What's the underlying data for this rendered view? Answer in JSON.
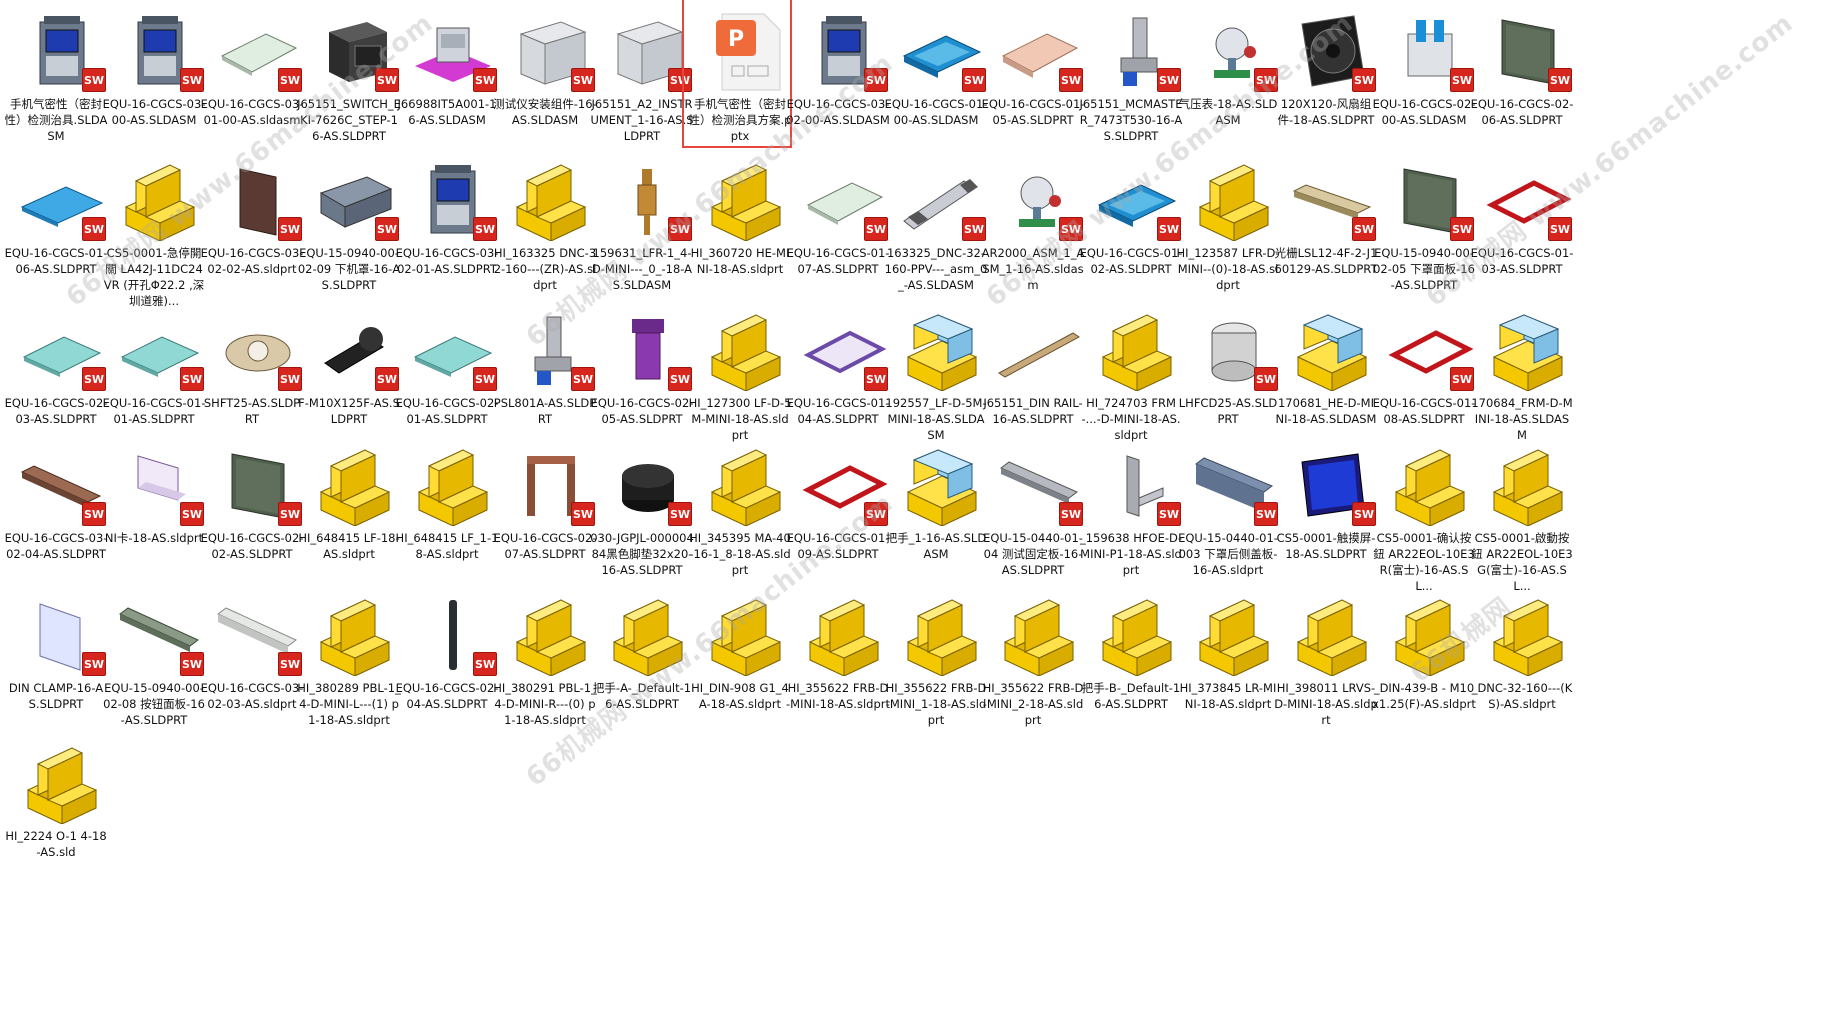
{
  "files": [
    {
      "label": "手机气密性（密封性）检测治具.SLDASM",
      "thumb": "machine",
      "sw": true
    },
    {
      "label": "EQU-16-CGCS-03-00-AS.SLDASM",
      "thumb": "machine",
      "sw": true
    },
    {
      "label": "EQU-16-CGCS-03-01-00-AS.sldasm",
      "thumb": "plate",
      "sw": true
    },
    {
      "label": "J65151_SWITCH_EKI-7626C_STEP-16-AS.SLDPRT",
      "thumb": "box-dark",
      "sw": true
    },
    {
      "label": "J66988IT5A001-16-AS.SLDASM",
      "thumb": "magenta",
      "sw": true
    },
    {
      "label": "测试仪安装组件-16-AS.SLDASM",
      "thumb": "box-gray",
      "sw": true
    },
    {
      "label": "J65151_A2_INSTRUMENT_1-16-AS.SLDPRT",
      "thumb": "box-gray",
      "sw": true
    },
    {
      "label": "手机气密性（密封性）检测治具方案.pptx",
      "thumb": "pptx",
      "sw": false,
      "selected": true
    },
    {
      "label": "EQU-16-CGCS-03-02-00-AS.SLDASM",
      "thumb": "machine",
      "sw": true
    },
    {
      "label": "EQU-16-CGCS-01-00-AS.SLDASM",
      "thumb": "blue-tray",
      "sw": true
    },
    {
      "label": "EQU-16-CGCS-01-05-AS.SLDPRT",
      "thumb": "plate-tan",
      "sw": true
    },
    {
      "label": "J65151_MCMASTER_7473T530-16-AS.SLDPRT",
      "thumb": "fitting",
      "sw": true
    },
    {
      "label": "气压表-18-AS.SLDASM",
      "thumb": "gauge",
      "sw": true
    },
    {
      "label": "120X120-风扇组件-18-AS.SLDPRT",
      "thumb": "fan",
      "sw": true
    },
    {
      "label": "EQU-16-CGCS-02-00-AS.SLDASM",
      "thumb": "frame-blue",
      "sw": true
    },
    {
      "label": "EQU-16-CGCS-02-06-AS.SLDPRT",
      "thumb": "plate-green",
      "sw": true
    },
    {
      "label": "EQU-16-CGCS-01-06-AS.SLDPRT",
      "thumb": "blue-plate",
      "sw": true
    },
    {
      "label": "CS5-0001-急停開關 LA42J-11DC24VR (开孔Φ22.2 ,深圳道雅)...",
      "thumb": "yellow",
      "sw": false
    },
    {
      "label": "EQU-16-CGCS-03-02-02-AS.sldprt",
      "thumb": "brown-panel",
      "sw": true
    },
    {
      "label": "EQU-15-0940-00-02-09 下机罩-16-AS.SLDPRT",
      "thumb": "cover",
      "sw": true
    },
    {
      "label": "EQU-16-CGCS-03-02-01-AS.SLDPRT",
      "thumb": "machine",
      "sw": true
    },
    {
      "label": "HI_163325 DNC-32-160---(ZR)-AS.sldprt",
      "thumb": "yellow",
      "sw": false
    },
    {
      "label": "159631_LFR-1_4-D-MINI---_0_-18-AS.SLDASM",
      "thumb": "valve",
      "sw": true
    },
    {
      "label": "HI_360720 HE-MINI-18-AS.sldprt",
      "thumb": "yellow",
      "sw": false
    },
    {
      "label": "EQU-16-CGCS-01-07-AS.SLDPRT",
      "thumb": "plate",
      "sw": true
    },
    {
      "label": "163325_DNC-32-160-PPV---_asm_0_-AS.SLDASM",
      "thumb": "cylinder",
      "sw": true
    },
    {
      "label": "AR2000_ASM_1_ASM_1-16-AS.sldasm",
      "thumb": "gauge",
      "sw": true
    },
    {
      "label": "EQU-16-CGCS-01-02-AS.SLDPRT",
      "thumb": "blue-tray",
      "sw": true
    },
    {
      "label": "HI_123587 LFR-D-MINI--(0)-18-AS.sldprt",
      "thumb": "yellow",
      "sw": false
    },
    {
      "label": "光栅LSL12-4F-2-J160129-AS.SLDPRT",
      "thumb": "rail",
      "sw": true
    },
    {
      "label": "EQU-15-0940-00-02-05 下罩面板-16-AS.SLDPRT",
      "thumb": "plate-green",
      "sw": true
    },
    {
      "label": "EQU-16-CGCS-01-03-AS.SLDPRT",
      "thumb": "red-ring",
      "sw": true
    },
    {
      "label": "EQU-16-CGCS-02-03-AS.SLDPRT",
      "thumb": "teal-plate",
      "sw": true
    },
    {
      "label": "EQU-16-CGCS-01-01-AS.SLDPRT",
      "thumb": "teal-plate",
      "sw": true
    },
    {
      "label": "SHFT25-AS.SLDPRT",
      "thumb": "bearing",
      "sw": true
    },
    {
      "label": "F-M10X125F-AS.SLDPRT",
      "thumb": "black-part",
      "sw": true
    },
    {
      "label": "EQU-16-CGCS-02-01-AS.SLDPRT",
      "thumb": "teal-plate",
      "sw": true
    },
    {
      "label": "PSL801A-AS.SLDPRT",
      "thumb": "fitting",
      "sw": true
    },
    {
      "label": "EQU-16-CGCS-02-05-AS.SLDPRT",
      "thumb": "purple",
      "sw": true
    },
    {
      "label": "HI_127300 LF-D-5M-MINI-18-AS.sldprt",
      "thumb": "yellow",
      "sw": false
    },
    {
      "label": "EQU-16-CGCS-01-04-AS.SLDPRT",
      "thumb": "purple-frame",
      "sw": true
    },
    {
      "label": "192557_LF-D-5M-MINI-18-AS.SLDASM",
      "thumb": "yellow-blue",
      "sw": false
    },
    {
      "label": "J65151_DIN RAIL-16-AS.SLDPRT",
      "thumb": "rod",
      "sw": false
    },
    {
      "label": "HI_724703 FRM-...-D-MINI-18-AS.sldprt",
      "thumb": "yellow",
      "sw": false
    },
    {
      "label": "LHFCD25-AS.SLDPRT",
      "thumb": "bushing",
      "sw": true
    },
    {
      "label": "170681_HE-D-MINI-18-AS.SLDASM",
      "thumb": "yellow-blue",
      "sw": false
    },
    {
      "label": "EQU-16-CGCS-01-08-AS.SLDPRT",
      "thumb": "red-ring",
      "sw": true
    },
    {
      "label": "170684_FRM-D-MINI-18-AS.SLDASM",
      "thumb": "yellow-blue",
      "sw": false
    },
    {
      "label": "EQU-16-CGCS-03-02-04-AS.SLDPRT",
      "thumb": "bar",
      "sw": true
    },
    {
      "label": "NI卡-18-AS.sldprt",
      "thumb": "bracket",
      "sw": true
    },
    {
      "label": "EQU-16-CGCS-02-02-AS.SLDPRT",
      "thumb": "plate-green",
      "sw": true
    },
    {
      "label": "HI_648415 LF-18-AS.sldprt",
      "thumb": "yellow",
      "sw": false
    },
    {
      "label": "HI_648415 LF_1-18-AS.sldprt",
      "thumb": "yellow",
      "sw": false
    },
    {
      "label": "EQU-16-CGCS-02-07-AS.SLDPRT",
      "thumb": "brown-frame",
      "sw": true
    },
    {
      "label": "030-JGPJL-00000484黑色脚垫32x20-16-AS.SLDPRT",
      "thumb": "foot",
      "sw": true
    },
    {
      "label": "HI_345395 MA-40-16-1_8-18-AS.sldprt",
      "thumb": "yellow",
      "sw": false
    },
    {
      "label": "EQU-16-CGCS-01-09-AS.SLDPRT",
      "thumb": "red-ring",
      "sw": true
    },
    {
      "label": "把手_1-16-AS.SLDASM",
      "thumb": "yellow-blue",
      "sw": false
    },
    {
      "label": "EQU-15-0440-01-04 测试固定板-16-AS.SLDPRT",
      "thumb": "bar-gray",
      "sw": true
    },
    {
      "label": "_159638 HFOE-D-MINI-P1-18-AS.sldprt",
      "thumb": "bracket-gray",
      "sw": true
    },
    {
      "label": "EQU-15-0440-01-003 下罩后侧盖板-16-AS.sldprt",
      "thumb": "bar-blue",
      "sw": true
    },
    {
      "label": "CS5-0001-触摸屏-18-AS.SLDPRT",
      "thumb": "screen",
      "sw": true
    },
    {
      "label": "CS5-0001-确认按鈕 AR22EOL-10E3R(富士)-16-AS.SL...",
      "thumb": "yellow",
      "sw": false
    },
    {
      "label": "CS5-0001-啟動按鈕 AR22EOL-10E3G(富士)-16-AS.SL...",
      "thumb": "yellow",
      "sw": false
    },
    {
      "label": "DIN CLAMP-16-AS.SLDPRT",
      "thumb": "clamp",
      "sw": true
    },
    {
      "label": "EQU-15-0940-00-02-08 按钮面板-16-AS.SLDPRT",
      "thumb": "bar-green",
      "sw": true
    },
    {
      "label": "EQU-16-CGCS-03-02-03-AS.sldprt",
      "thumb": "bar-light",
      "sw": true
    },
    {
      "label": "HI_380289 PBL-1_4-D-MINI-L---(1) p1-18-AS.sldprt",
      "thumb": "yellow",
      "sw": false
    },
    {
      "label": "EQU-16-CGCS-02-04-AS.SLDPRT",
      "thumb": "pin",
      "sw": true
    },
    {
      "label": "HI_380291 PBL-1_4-D-MINI-R---(0) p1-18-AS.sldprt",
      "thumb": "yellow",
      "sw": false
    },
    {
      "label": "把手-A-_Default-16-AS.SLDPRT",
      "thumb": "yellow",
      "sw": false
    },
    {
      "label": "HI_DIN-908 G1_4A-18-AS.sldprt",
      "thumb": "yellow",
      "sw": false
    },
    {
      "label": "HI_355622 FRB-D-MINI-18-AS.sldprt",
      "thumb": "yellow",
      "sw": false
    },
    {
      "label": "HI_355622 FRB-D-MINI_1-18-AS.sldprt",
      "thumb": "yellow",
      "sw": false
    },
    {
      "label": "HI_355622 FRB-D-MINI_2-18-AS.sldprt",
      "thumb": "yellow",
      "sw": false
    },
    {
      "label": "把手-B-_Default-16-AS.SLDPRT",
      "thumb": "yellow",
      "sw": false
    },
    {
      "label": "HI_373845 LR-MINI-18-AS.sldprt",
      "thumb": "yellow",
      "sw": false
    },
    {
      "label": "HI_398011 LRVS-D-MINI-18-AS.sldprt",
      "thumb": "yellow",
      "sw": false
    },
    {
      "label": "_DIN-439-B - M10x1.25(F)-AS.sldprt",
      "thumb": "yellow",
      "sw": false
    },
    {
      "label": "_DNC-32-160---(KS)-AS.sldprt",
      "thumb": "yellow",
      "sw": false
    },
    {
      "label": "HI_2224 O-1 4-18-AS.sld",
      "thumb": "yellow",
      "sw": false
    }
  ],
  "watermarks": [
    "66机械网 www.66machine.com",
    "66机械网 www.66machine.com",
    "66机械网 www.66machine.com",
    "66机械网 www.66machine.com",
    "66机械网 www.66machine.com",
    "66机械网"
  ],
  "sw_badge": "SW"
}
